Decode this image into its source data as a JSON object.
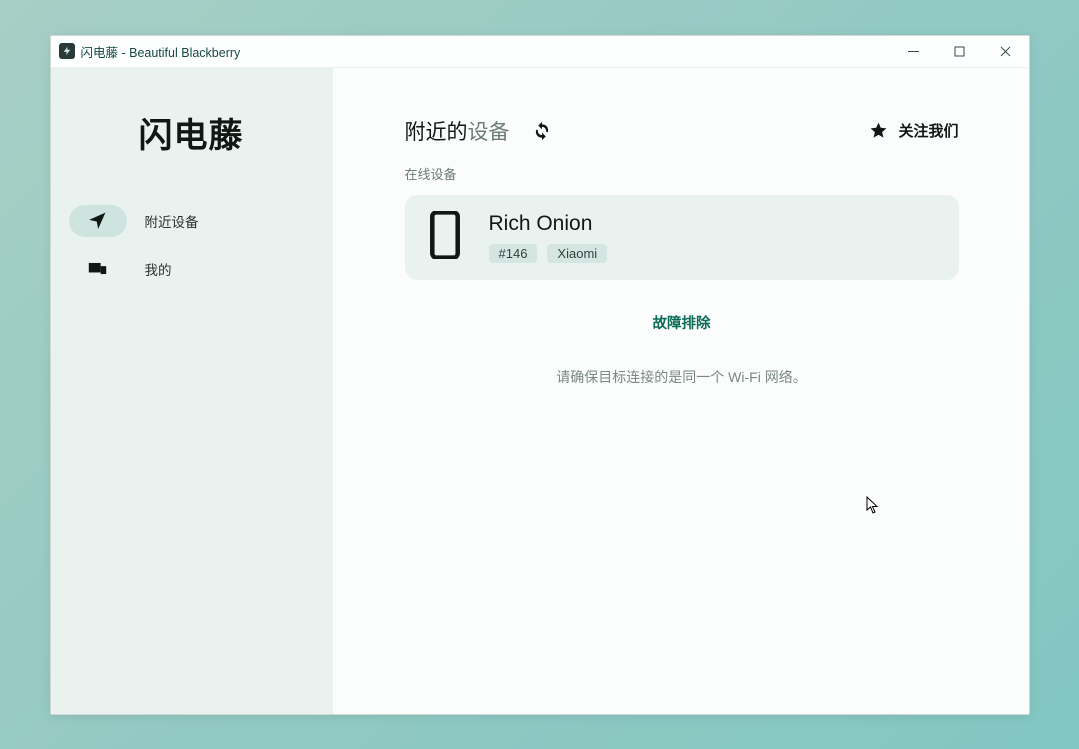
{
  "window": {
    "title": "闪电藤 - Beautiful Blackberry"
  },
  "sidebar": {
    "brand": "闪电藤",
    "items": [
      {
        "label": "附近设备"
      },
      {
        "label": "我的"
      }
    ]
  },
  "main": {
    "title_prefix": "附近的",
    "title_suffix": "设备",
    "follow_us": "关注我们",
    "section_label": "在线设备",
    "device": {
      "name": "Rich Onion",
      "id_tag": "#146",
      "brand_tag": "Xiaomi"
    },
    "troubleshoot": "故障排除",
    "hint": "请确保目标连接的是同一个 Wi-Fi 网络。"
  }
}
